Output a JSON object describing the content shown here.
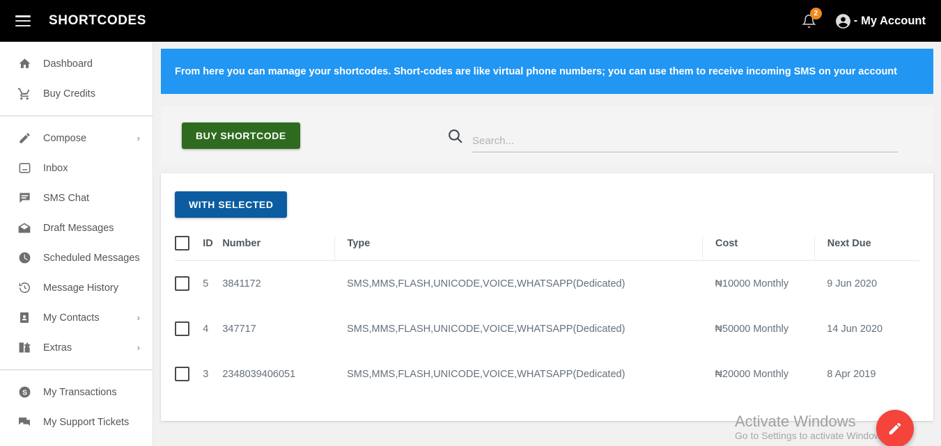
{
  "topbar": {
    "menu_icon": "hamburger-icon",
    "brand": "SHORTCODES",
    "notification_icon": "bell-icon",
    "notification_count": "2",
    "account_icon": "user-circle-icon",
    "account_label": "My Account",
    "account_separator": "-",
    "background_color": "#000000",
    "badge_color": "#f08a1e"
  },
  "sidebar": {
    "groups": [
      {
        "items": [
          {
            "icon": "home-icon",
            "label": "Dashboard",
            "caret": ""
          },
          {
            "icon": "shopping-cart-icon",
            "label": "Buy Credits",
            "caret": ""
          }
        ]
      },
      {
        "items": [
          {
            "icon": "pencil-icon",
            "label": "Compose",
            "caret": "›"
          },
          {
            "icon": "inbox-icon",
            "label": "Inbox",
            "caret": ""
          },
          {
            "icon": "chat-bubble-icon",
            "label": "SMS Chat",
            "caret": ""
          },
          {
            "icon": "envelope-open-icon",
            "label": "Draft Messages",
            "caret": ""
          },
          {
            "icon": "clock-icon",
            "label": "Scheduled Messages",
            "caret": ""
          },
          {
            "icon": "history-icon",
            "label": "Message History",
            "caret": ""
          },
          {
            "icon": "contacts-book-icon",
            "label": "My Contacts",
            "caret": "›"
          },
          {
            "icon": "extras-grid-icon",
            "label": "Extras",
            "caret": "›"
          }
        ]
      },
      {
        "items": [
          {
            "icon": "dollar-circle-icon",
            "label": "My Transactions",
            "caret": ""
          },
          {
            "icon": "support-chat-icon",
            "label": "My Support Tickets",
            "caret": ""
          }
        ]
      }
    ]
  },
  "main": {
    "banner": {
      "text": "From here you can manage your shortcodes. Short-codes are like virtual phone numbers; you can use them to receive incoming SMS on your account",
      "color": "#2196f3"
    },
    "buy_button": {
      "label": "BUY SHORTCODE",
      "color": "#2e6b1f"
    },
    "search": {
      "icon": "search-icon",
      "placeholder": "Search...",
      "value": ""
    },
    "with_selected_button": {
      "label": "WITH SELECTED",
      "color": "#0b5ca0"
    },
    "table": {
      "select_all_checkbox": "",
      "columns": [
        "ID",
        "Number",
        "Type",
        "Cost",
        "Next Due"
      ],
      "rows": [
        {
          "id": "5",
          "number": "3841172",
          "type": "SMS,MMS,FLASH,UNICODE,VOICE,WHATSAPP(Dedicated)",
          "cost": "₦10000 Monthly",
          "next_due": "9 Jun 2020"
        },
        {
          "id": "4",
          "number": "347717",
          "type": "SMS,MMS,FLASH,UNICODE,VOICE,WHATSAPP(Dedicated)",
          "cost": "₦50000 Monthly",
          "next_due": "14 Jun 2020"
        },
        {
          "id": "3",
          "number": "2348039406051",
          "type": "SMS,MMS,FLASH,UNICODE,VOICE,WHATSAPP(Dedicated)",
          "cost": "₦20000 Monthly",
          "next_due": "8 Apr 2019"
        }
      ]
    },
    "fab": {
      "icon": "pencil-icon",
      "color": "#f4443c"
    }
  },
  "watermark": {
    "line1": "Activate Windows",
    "line2": "Go to Settings to activate Windows."
  }
}
